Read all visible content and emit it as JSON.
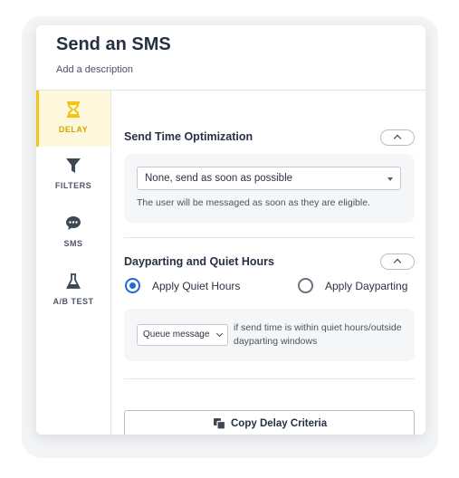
{
  "header": {
    "title": "Send an SMS",
    "description_placeholder": "Add a description"
  },
  "sidebar": {
    "items": [
      {
        "label": "DELAY",
        "icon": "hourglass-icon",
        "active": true
      },
      {
        "label": "FILTERS",
        "icon": "filter-icon",
        "active": false
      },
      {
        "label": "SMS",
        "icon": "chat-bubble-icon",
        "active": false
      },
      {
        "label": "A/B TEST",
        "icon": "flask-icon",
        "active": false
      }
    ]
  },
  "send_time": {
    "title": "Send Time Optimization",
    "select_value": "None, send as soon as possible",
    "hint": "The user will be messaged as soon as they are eligible."
  },
  "dayparting": {
    "title": "Dayparting and Quiet Hours",
    "options": [
      {
        "label": "Apply Quiet Hours",
        "checked": true
      },
      {
        "label": "Apply Dayparting",
        "checked": false
      }
    ],
    "action_value": "Queue message",
    "action_text": "if send time is within quiet hours/outside dayparting windows"
  },
  "copy_button": {
    "label": "Copy Delay Criteria"
  },
  "colors": {
    "accent": "#f0c419",
    "active_bg": "#fdf8dc",
    "radio": "#2468d8"
  }
}
